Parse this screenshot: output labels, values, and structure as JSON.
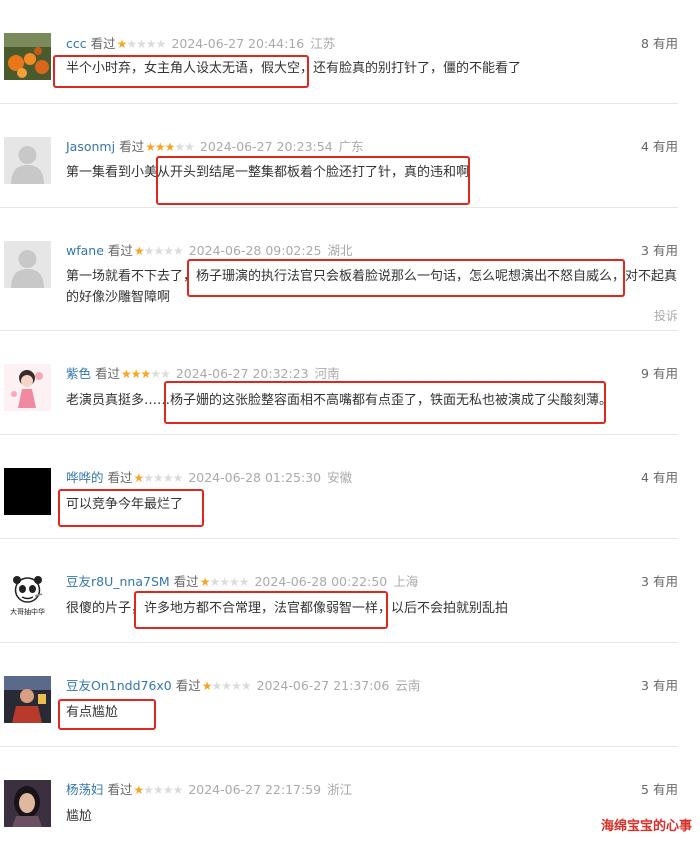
{
  "comments": [
    {
      "username": "ccc",
      "watched": "看过",
      "rating": 1,
      "time": "2024-06-27 20:44:16",
      "location": "江苏",
      "useful_count": "8",
      "useful_label": "有用",
      "text": "半个小时弃，女主角人设太无语，假大空，还有脸真的别打针了，僵的不能看了",
      "avatar": "orange-flowers-photo"
    },
    {
      "username": "Jasonmj",
      "watched": "看过",
      "rating": 3,
      "time": "2024-06-27 20:23:54",
      "location": "广东",
      "useful_count": "4",
      "useful_label": "有用",
      "text": "第一集看到小美从开头到结尾一整集都板着个脸还打了针，真的违和啊",
      "avatar": "default-user-icon"
    },
    {
      "username": "wfane",
      "watched": "看过",
      "rating": 1,
      "time": "2024-06-28 09:02:25",
      "location": "湖北",
      "useful_count": "3",
      "useful_label": "有用",
      "text": "第一场就看不下去了，杨子珊演的执行法官只会板着脸说那么一句话，怎么呢想演出不怒自威么，对不起真的好像沙雕智障啊",
      "avatar": "default-user-icon",
      "report": "投诉"
    },
    {
      "username": "紫色",
      "watched": "看过",
      "rating": 3,
      "time": "2024-06-27 20:32:23",
      "location": "河南",
      "useful_count": "9",
      "useful_label": "有用",
      "text": "老演员真挺多……杨子姗的这张脸整容面相不高嘴都有点歪了，铁面无私也被演成了尖酸刻薄。",
      "avatar": "cartoon-girl-avatar"
    },
    {
      "username": "哗哗的",
      "watched": "看过",
      "rating": 1,
      "time": "2024-06-28 01:25:30",
      "location": "安徽",
      "useful_count": "4",
      "useful_label": "有用",
      "text": "可以竞争今年最烂了",
      "avatar": "black-square-avatar"
    },
    {
      "username": "豆友r8U_nna7SM",
      "watched": "看过",
      "rating": 1,
      "time": "2024-06-28 00:22:50",
      "location": "上海",
      "useful_count": "3",
      "useful_label": "有用",
      "text": "很傻的片子，许多地方都不合常理，法官都像弱智一样，以后不会拍就别乱拍",
      "avatar": "panda-meme-avatar",
      "avatar_caption": "大哥抽中华"
    },
    {
      "username": "豆友On1ndd76x0",
      "watched": "看过",
      "rating": 1,
      "time": "2024-06-27 21:37:06",
      "location": "云南",
      "useful_count": "3",
      "useful_label": "有用",
      "text": "有点尴尬",
      "avatar": "person-photo-avatar"
    },
    {
      "username": "杨荡妇",
      "watched": "看过",
      "rating": 1,
      "time": "2024-06-27 22:17:59",
      "location": "浙江",
      "useful_count": "5",
      "useful_label": "有用",
      "text": "尴尬",
      "avatar": "woman-photo-avatar"
    }
  ],
  "watermark": "海绵宝宝的心事",
  "highlight_color": "#e0261f",
  "star_color": "#f5a623",
  "username_color": "#3377aa"
}
